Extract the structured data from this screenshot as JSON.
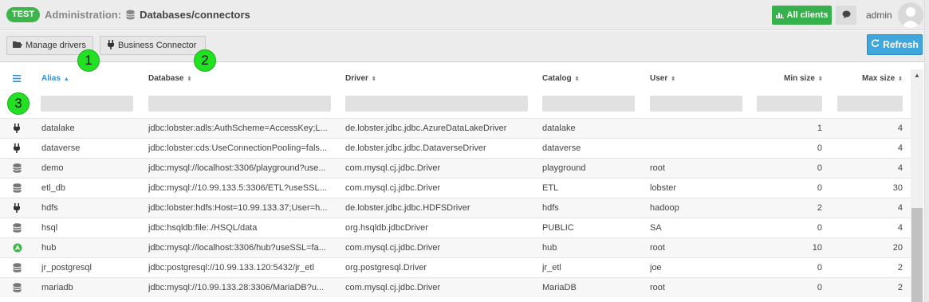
{
  "header": {
    "env_badge": "TEST",
    "section": "Administration:",
    "page": "Databases/connectors",
    "all_clients_label": "All clients",
    "user_name": "admin"
  },
  "toolbar": {
    "manage_drivers_label": "Manage drivers",
    "business_connector_label": "Business Connector",
    "refresh_label": "Refresh"
  },
  "markers": [
    "1",
    "2",
    "3"
  ],
  "columns": {
    "alias": "Alias",
    "database": "Database",
    "driver": "Driver",
    "catalog": "Catalog",
    "user": "User",
    "min_size": "Min size",
    "max_size": "Max size"
  },
  "rows": [
    {
      "icon": "plug-icon",
      "alias": "datalake",
      "database": "jdbc:lobster:adls:AuthScheme=AccessKey;L...",
      "driver": "de.lobster.jdbc.jdbc.AzureDataLakeDriver",
      "catalog": "datalake",
      "user": "",
      "min": "1",
      "max": "4"
    },
    {
      "icon": "plug-icon",
      "alias": "dataverse",
      "database": "jdbc:lobster:cds:UseConnectionPooling=fals...",
      "driver": "de.lobster.jdbc.jdbc.DataverseDriver",
      "catalog": "dataverse",
      "user": "",
      "min": "0",
      "max": "4"
    },
    {
      "icon": "database-icon",
      "alias": "demo",
      "database": "jdbc:mysql://localhost:3306/playground?use...",
      "driver": "com.mysql.cj.jdbc.Driver",
      "catalog": "playground",
      "user": "root",
      "min": "0",
      "max": "4"
    },
    {
      "icon": "database-icon",
      "alias": "etl_db",
      "database": "jdbc:mysql://10.99.133.5:3306/ETL?useSSL...",
      "driver": "com.mysql.cj.jdbc.Driver",
      "catalog": "ETL",
      "user": "lobster",
      "min": "0",
      "max": "30"
    },
    {
      "icon": "plug-icon",
      "alias": "hdfs",
      "database": "jdbc:lobster:hdfs:Host=10.99.133.37;User=h...",
      "driver": "de.lobster.jdbc.jdbc.HDFSDriver",
      "catalog": "hdfs",
      "user": "hadoop",
      "min": "2",
      "max": "4"
    },
    {
      "icon": "database-icon",
      "alias": "hsql",
      "database": "jdbc:hsqldb:file:./HSQL/data",
      "driver": "org.hsqldb.jdbcDriver",
      "catalog": "PUBLIC",
      "user": "SA",
      "min": "0",
      "max": "4"
    },
    {
      "icon": "hub-icon",
      "alias": "hub",
      "database": "jdbc:mysql://localhost:3306/hub?useSSL=fa...",
      "driver": "com.mysql.cj.jdbc.Driver",
      "catalog": "hub",
      "user": "root",
      "min": "10",
      "max": "20"
    },
    {
      "icon": "database-icon",
      "alias": "jr_postgresql",
      "database": "jdbc:postgresql://10.99.133.120:5432/jr_etl",
      "driver": "org.postgresql.Driver",
      "catalog": "jr_etl",
      "user": "joe",
      "min": "0",
      "max": "2"
    },
    {
      "icon": "database-icon",
      "alias": "mariadb",
      "database": "jdbc:mysql://10.99.133.28:3306/MariaDB?u...",
      "driver": "com.mysql.cj.jdbc.Driver",
      "catalog": "MariaDB",
      "user": "root",
      "min": "0",
      "max": "2"
    }
  ],
  "colors": {
    "badge": "#3cb54a",
    "all_clients": "#36b14b",
    "refresh": "#3fa7dc",
    "sorted_header": "#3a8fd0",
    "marker": "#22e022",
    "hub_icon": "#3cb54a"
  }
}
